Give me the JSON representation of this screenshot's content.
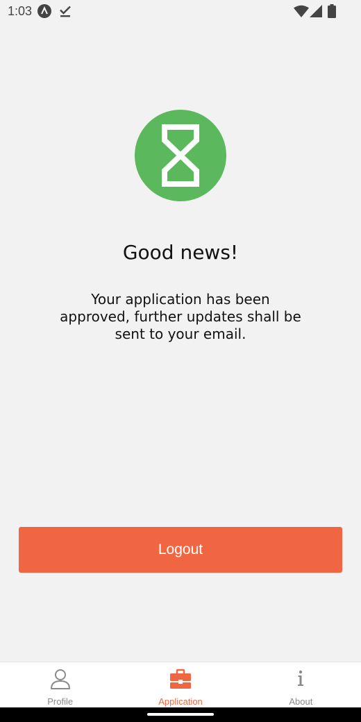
{
  "status_bar": {
    "time": "1:03",
    "icons": [
      "app-notification-icon",
      "download-done-icon",
      "wifi-icon",
      "cell-signal-icon",
      "battery-icon"
    ]
  },
  "main": {
    "icon": "hourglass-icon",
    "headline": "Good news!",
    "message": "Your application has been approved, further updates shall be sent to your email.",
    "logout_label": "Logout"
  },
  "tabs": [
    {
      "label": "Profile",
      "icon": "person-icon",
      "active": false
    },
    {
      "label": "Application",
      "icon": "briefcase-icon",
      "active": true
    },
    {
      "label": "About",
      "icon": "info-icon",
      "active": false
    }
  ],
  "colors": {
    "background": "#f2f2f2",
    "accent": "#f16642",
    "success": "#5cb85c",
    "inactive_tab": "#8a8a8a"
  }
}
